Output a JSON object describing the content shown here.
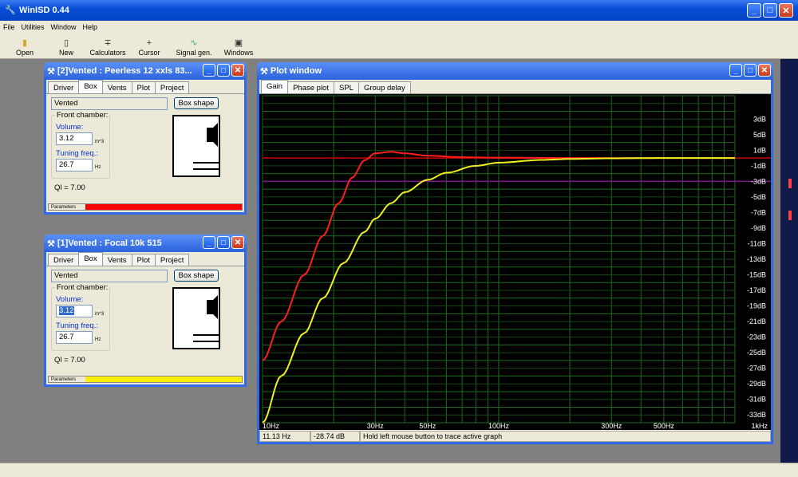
{
  "app": {
    "title": "WinISD 0.44"
  },
  "menu": [
    "File",
    "Utilities",
    "Window",
    "Help"
  ],
  "toolbar": [
    "Open",
    "New",
    "Calculators",
    "Cursor",
    "Signal gen.",
    "Windows"
  ],
  "win1": {
    "title": "[2]Vented : Peerless 12 xxls 83...",
    "tabs": [
      "Driver",
      "Box",
      "Vents",
      "Plot",
      "Project"
    ],
    "box_type": "Vented",
    "box_shape_btn": "Box shape",
    "group_label": "Front chamber:",
    "volume_label": "Volume:",
    "volume": "3.12",
    "volume_unit": "m^3",
    "tuning_label": "Tuning freq.:",
    "tuning": "26.7",
    "tuning_unit": "Hz",
    "ql": "Ql = 7.00",
    "status": "Parameters",
    "color": "#ff0000"
  },
  "win2": {
    "title": "[1]Vented : Focal 10k 515",
    "tabs": [
      "Driver",
      "Box",
      "Vents",
      "Plot",
      "Project"
    ],
    "box_type": "Vented",
    "box_shape_btn": "Box shape",
    "group_label": "Front chamber:",
    "volume_label": "Volume:",
    "volume": "3.12",
    "volume_unit": "m^3",
    "tuning_label": "Tuning freq.:",
    "tuning": "26.7",
    "tuning_unit": "Hz",
    "ql": "Ql = 7.00",
    "status": "Parameters",
    "color": "#ffee00"
  },
  "plot": {
    "title": "Plot window",
    "tabs": [
      "Gain",
      "Phase plot",
      "SPL",
      "Group delay"
    ],
    "status_freq": "11.13 Hz",
    "status_db": "-28.74 dB",
    "status_msg": "Hold left mouse button to trace active graph"
  },
  "chart_data": {
    "type": "line",
    "x_scale": "log",
    "xlim": [
      10,
      1000
    ],
    "ylim": [
      -34,
      8
    ],
    "x_tick_labels": [
      {
        "x": 10,
        "label": "10Hz"
      },
      {
        "x": 30,
        "label": "30Hz"
      },
      {
        "x": 50,
        "label": "50Hz"
      },
      {
        "x": 100,
        "label": "100Hz"
      },
      {
        "x": 300,
        "label": "300Hz"
      },
      {
        "x": 500,
        "label": "500Hz"
      },
      {
        "x": 1000,
        "label": "1kHz"
      }
    ],
    "y_tick_labels": [
      {
        "y": 5,
        "label": "3dB"
      },
      {
        "y": 3,
        "label": "5dB"
      },
      {
        "y": 1,
        "label": "1dB"
      },
      {
        "y": -1,
        "label": "-1dB"
      },
      {
        "y": -3,
        "label": "-3dB"
      },
      {
        "y": -5,
        "label": "-5dB"
      },
      {
        "y": -7,
        "label": "-7dB"
      },
      {
        "y": -9,
        "label": "-9dB"
      },
      {
        "y": -11,
        "label": "-11dB"
      },
      {
        "y": -13,
        "label": "-13dB"
      },
      {
        "y": -15,
        "label": "-15dB"
      },
      {
        "y": -17,
        "label": "-17dB"
      },
      {
        "y": -19,
        "label": "-19dB"
      },
      {
        "y": -21,
        "label": "-21dB"
      },
      {
        "y": -23,
        "label": "-23dB"
      },
      {
        "y": -25,
        "label": "-25dB"
      },
      {
        "y": -27,
        "label": "-27dB"
      },
      {
        "y": -29,
        "label": "-29dB"
      },
      {
        "y": -31,
        "label": "-31dB"
      },
      {
        "y": -33,
        "label": "-33dB"
      }
    ],
    "reference_lines": [
      {
        "y": 0,
        "color": "#cc0000"
      },
      {
        "y": -3,
        "color": "#7a1a8a"
      }
    ],
    "series": [
      {
        "color": "#ff1e1e",
        "x": [
          10,
          12,
          15,
          18,
          21,
          24,
          27,
          30,
          35,
          40,
          50,
          70,
          100,
          200,
          1000
        ],
        "y": [
          -26,
          -21,
          -15,
          -10,
          -5.8,
          -2.5,
          -0.3,
          0.6,
          0.8,
          0.6,
          0.3,
          0.1,
          0.05,
          0.0,
          0.0
        ]
      },
      {
        "color": "#f0f020",
        "x": [
          10,
          12,
          15,
          18,
          22,
          27,
          30,
          35,
          40,
          50,
          60,
          80,
          100,
          150,
          200,
          300,
          500,
          1000
        ],
        "y": [
          -34,
          -28,
          -22.5,
          -18,
          -13.5,
          -9.5,
          -7.8,
          -5.8,
          -4.4,
          -2.8,
          -1.9,
          -1.0,
          -0.6,
          -0.25,
          -0.12,
          -0.04,
          0.0,
          0.0
        ]
      }
    ]
  }
}
